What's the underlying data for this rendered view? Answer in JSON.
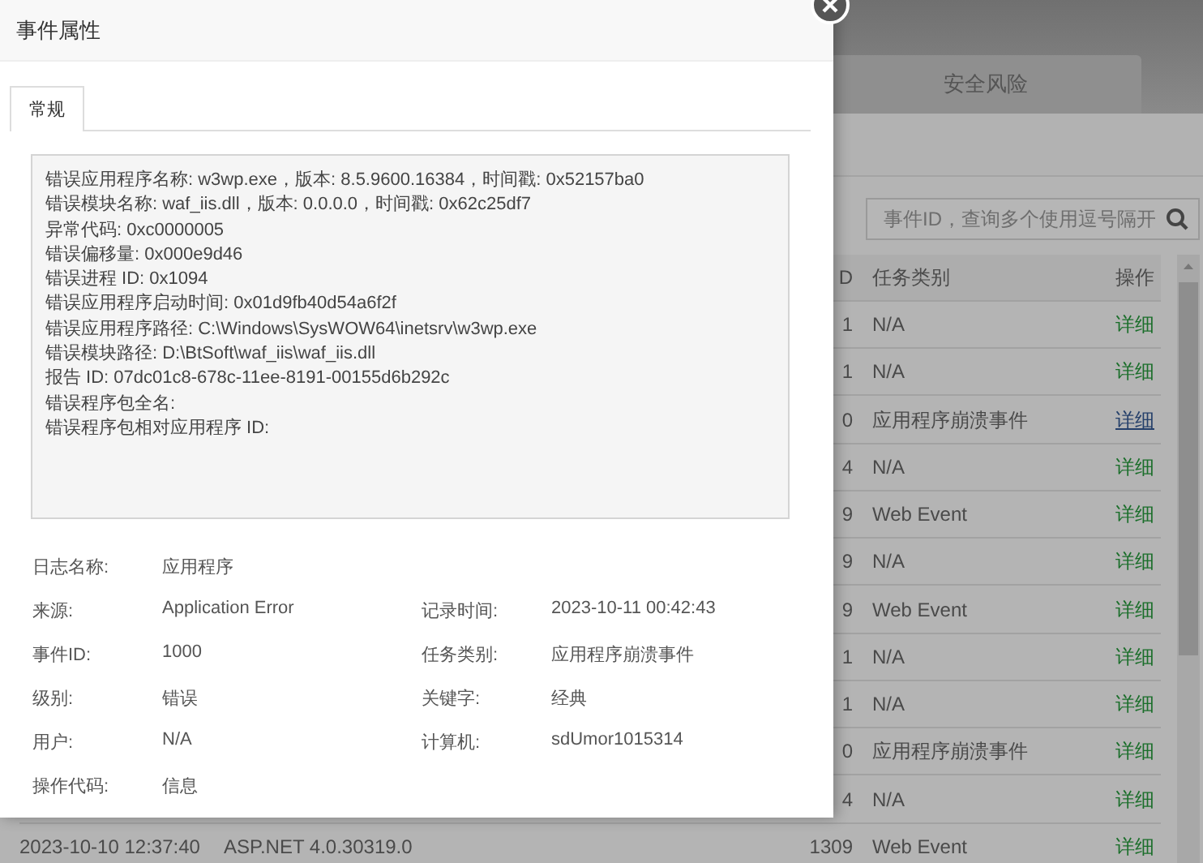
{
  "background": {
    "tab": "安全风险",
    "search": {
      "placeholder": "事件ID，查询多个使用逗号隔开"
    },
    "table": {
      "columns": [
        {
          "label": "D"
        },
        {
          "label": "任务类别"
        },
        {
          "label": "操作"
        }
      ],
      "rows": [
        {
          "id": "1",
          "category": "N/A",
          "action": "详细",
          "visited": false
        },
        {
          "id": "1",
          "category": "N/A",
          "action": "详细",
          "visited": false
        },
        {
          "id": "0",
          "category": "应用程序崩溃事件",
          "action": "详细",
          "visited": true
        },
        {
          "id": "4",
          "category": "N/A",
          "action": "详细",
          "visited": false
        },
        {
          "id": "9",
          "category": "Web Event",
          "action": "详细",
          "visited": false
        },
        {
          "id": "9",
          "category": "N/A",
          "action": "详细",
          "visited": false
        },
        {
          "id": "9",
          "category": "Web Event",
          "action": "详细",
          "visited": false
        },
        {
          "id": "1",
          "category": "N/A",
          "action": "详细",
          "visited": false
        },
        {
          "id": "1",
          "category": "N/A",
          "action": "详细",
          "visited": false
        },
        {
          "id": "0",
          "category": "应用程序崩溃事件",
          "action": "详细",
          "visited": false
        },
        {
          "id": "4",
          "category": "N/A",
          "action": "详细",
          "visited": false
        },
        {
          "time": "2023-10-10 12:37:40",
          "source": "ASP.NET 4.0.30319.0",
          "id": "1309",
          "category": "Web Event",
          "action": "详细",
          "visited": false
        }
      ]
    }
  },
  "dialog": {
    "title": "事件属性",
    "tabs": [
      {
        "label": "常规",
        "selected": true
      }
    ],
    "details": [
      "错误应用程序名称: w3wp.exe，版本: 8.5.9600.16384，时间戳: 0x52157ba0",
      "错误模块名称: waf_iis.dll，版本: 0.0.0.0，时间戳: 0x62c25df7",
      "异常代码: 0xc0000005",
      "错误偏移量: 0x000e9d46",
      "错误进程 ID: 0x1094",
      "错误应用程序启动时间: 0x01d9fb40d54a6f2f",
      "错误应用程序路径: C:\\Windows\\SysWOW64\\inetsrv\\w3wp.exe",
      "错误模块路径: D:\\BtSoft\\waf_iis\\waf_iis.dll",
      "报告 ID: 07dc01c8-678c-11ee-8191-00155d6b292c",
      "错误程序包全名:",
      "错误程序包相对应用程序 ID:"
    ],
    "fields": [
      [
        {
          "label": "日志名称:",
          "value": "应用程序"
        }
      ],
      [
        {
          "label": "来源:",
          "value": "Application Error"
        },
        {
          "label": "记录时间:",
          "value": "2023-10-11 00:42:43"
        }
      ],
      [
        {
          "label": "事件ID:",
          "value": "1000"
        },
        {
          "label": "任务类别:",
          "value": "应用程序崩溃事件"
        }
      ],
      [
        {
          "label": "级别:",
          "value": "错误"
        },
        {
          "label": "关键字:",
          "value": "经典"
        }
      ],
      [
        {
          "label": "用户:",
          "value": "N/A"
        },
        {
          "label": "计算机:",
          "value": "sdUmor1015314"
        }
      ],
      [
        {
          "label": "操作代码:",
          "value": "信息"
        }
      ]
    ]
  }
}
